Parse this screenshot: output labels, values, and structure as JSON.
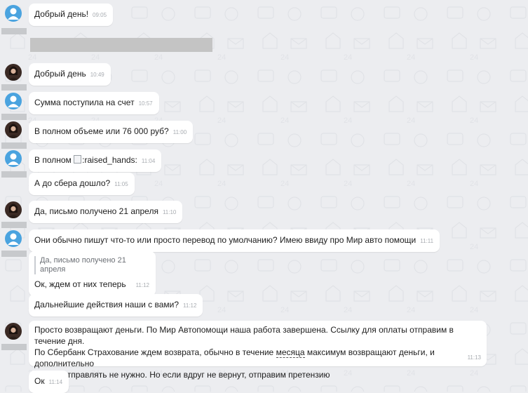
{
  "messages": [
    {
      "sender": "user",
      "text": "Добрый день!",
      "time": "09:05"
    },
    {
      "sender": "agent",
      "text": "Добрый день",
      "time": "10:49"
    },
    {
      "sender": "user",
      "text": "Сумма поступила на счет",
      "time": "10:57"
    },
    {
      "sender": "agent",
      "text": "В полном объеме или 76 000 руб?",
      "time": "11:00"
    },
    {
      "sender": "user",
      "text_before": "В полном",
      "image_alt": ":raised_hands:",
      "time": "11:04"
    },
    {
      "sender": "user",
      "text": "А до сбера дошло?",
      "time": "11:05"
    },
    {
      "sender": "agent",
      "text": "Да, письмо получено 21 апреля",
      "time": "11:10"
    },
    {
      "sender": "user",
      "text": "Они обычно пишут что-то или просто перевод по умолчанию? Имею ввиду про Мир авто помощи",
      "time": "11:11"
    },
    {
      "sender": "user",
      "quote": "Да, письмо получено 21 апреля",
      "text": "Ок, ждем от них теперь",
      "time": "11:12"
    },
    {
      "sender": "user",
      "text": "Дальнейшие действия наши с вами?",
      "time": "11:12"
    },
    {
      "sender": "agent",
      "line1": "Просто возвращают деньги. По Мир Автопомощи наша работа завершена. Ссылку для оплаты отправим в течение дня.",
      "line2_a": "По Сбербанк Страхование ждем возврата, обычно в течение ",
      "line2_underlined": "месяца",
      "line2_b": " максимум возвращают деньги, и дополнительно",
      "line3": "ничего отправлять не нужно. Но если вдруг не вернут, отправим претензию",
      "time": "11:13"
    },
    {
      "sender": "user",
      "text": "Ок",
      "time": "11:14"
    }
  ]
}
